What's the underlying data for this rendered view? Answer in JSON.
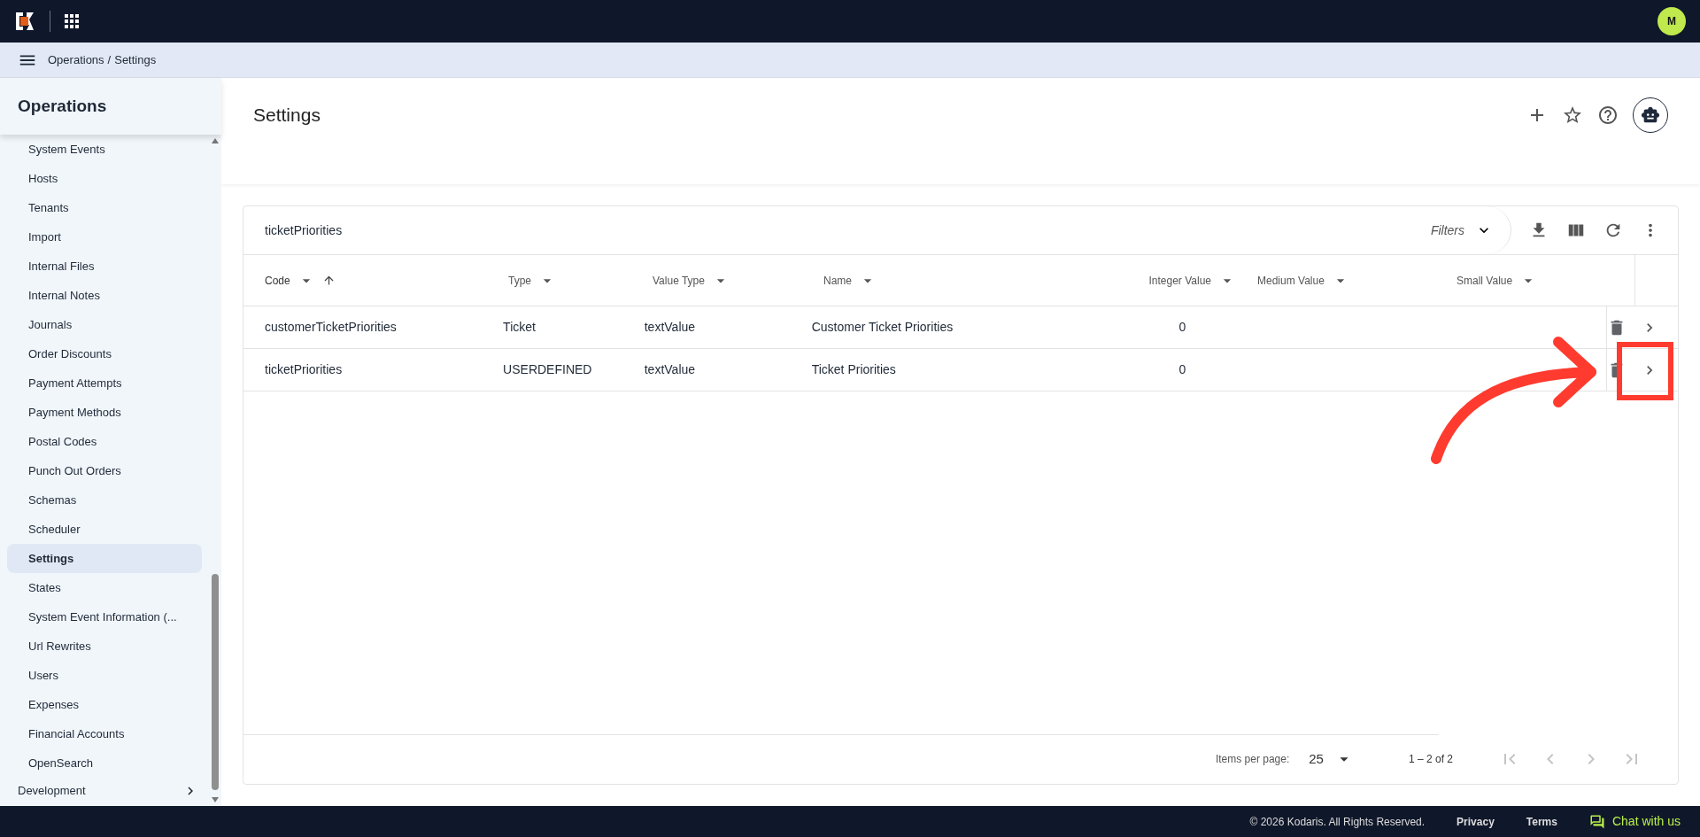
{
  "top_bar": {
    "avatar": "M"
  },
  "breadcrumb": [
    {
      "label": "Operations"
    },
    {
      "label": "/"
    },
    {
      "label": "Settings"
    }
  ],
  "sidebar": {
    "title": "Operations",
    "items": [
      {
        "label": "System Events",
        "selected": false
      },
      {
        "label": "Hosts",
        "selected": false
      },
      {
        "label": "Tenants",
        "selected": false
      },
      {
        "label": "Import",
        "selected": false
      },
      {
        "label": "Internal Files",
        "selected": false
      },
      {
        "label": "Internal Notes",
        "selected": false
      },
      {
        "label": "Journals",
        "selected": false
      },
      {
        "label": "Order Discounts",
        "selected": false
      },
      {
        "label": "Payment Attempts",
        "selected": false
      },
      {
        "label": "Payment Methods",
        "selected": false
      },
      {
        "label": "Postal Codes",
        "selected": false
      },
      {
        "label": "Punch Out Orders",
        "selected": false
      },
      {
        "label": "Schemas",
        "selected": false
      },
      {
        "label": "Scheduler",
        "selected": false
      },
      {
        "label": "Settings",
        "selected": true
      },
      {
        "label": "States",
        "selected": false
      },
      {
        "label": "System Event Information (...",
        "selected": false
      },
      {
        "label": "Url Rewrites",
        "selected": false
      },
      {
        "label": "Users",
        "selected": false
      },
      {
        "label": "Expenses",
        "selected": false
      },
      {
        "label": "Financial Accounts",
        "selected": false
      },
      {
        "label": "OpenSearch",
        "selected": false
      }
    ],
    "sections": [
      {
        "label": "Development",
        "expanded": false
      }
    ]
  },
  "page": {
    "title": "Settings"
  },
  "table": {
    "search": {
      "value": "ticketPriorities"
    },
    "filters": "Filters",
    "columns": [
      {
        "label": "Code",
        "sorted": true
      },
      {
        "label": "Type",
        "sorted": false
      },
      {
        "label": "Value Type",
        "sorted": false
      },
      {
        "label": "Name",
        "sorted": false
      },
      {
        "label": "Integer Value",
        "sorted": false
      },
      {
        "label": "Medium Value",
        "sorted": false
      },
      {
        "label": "Small Value",
        "sorted": false
      }
    ],
    "rows": [
      {
        "cells": [
          "customerTicketPriorities",
          "Ticket",
          "textValue",
          "Customer Ticket Priorities",
          "0",
          "",
          ""
        ],
        "highlighted": false
      },
      {
        "cells": [
          "ticketPriorities",
          "USERDEFINED",
          "textValue",
          "Ticket Priorities",
          "0",
          "",
          ""
        ],
        "highlighted": true
      }
    ],
    "pagination": {
      "label": "Items per page:",
      "page_size": "25",
      "range": "1 – 2 of 2",
      "buttons": [
        {
          "kind": "first",
          "disabled": true
        },
        {
          "kind": "prev",
          "disabled": true
        },
        {
          "kind": "next",
          "disabled": true
        },
        {
          "kind": "last",
          "disabled": true
        }
      ]
    }
  },
  "footer": {
    "copyright": "© 2026 Kodaris. All Rights Reserved.",
    "links": [
      "Privacy",
      "Terms"
    ],
    "chat": "Chat with us"
  }
}
